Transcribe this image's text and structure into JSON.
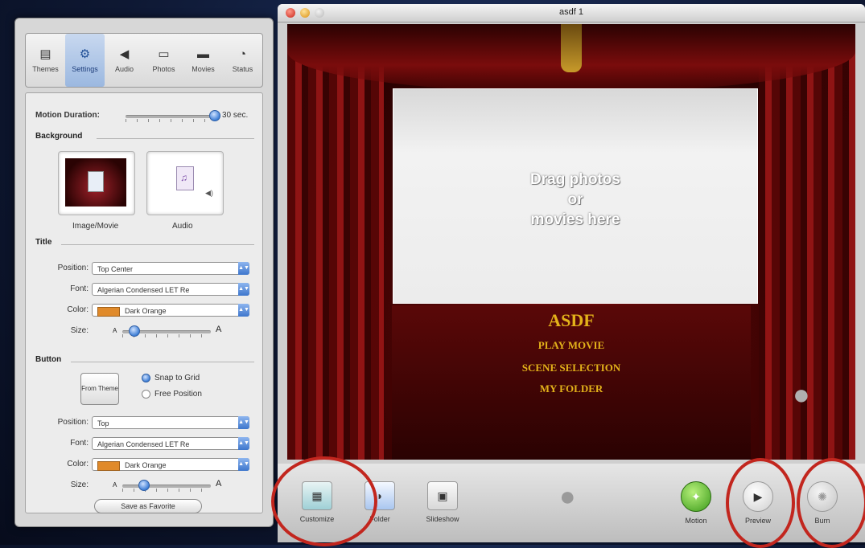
{
  "drawer": {
    "tabs": [
      {
        "label": "Themes",
        "icon": "themes-icon",
        "glyph": "▤"
      },
      {
        "label": "Settings",
        "icon": "gear-icon",
        "glyph": "⚙"
      },
      {
        "label": "Audio",
        "icon": "speaker-icon",
        "glyph": "◀"
      },
      {
        "label": "Photos",
        "icon": "photo-icon",
        "glyph": "▭"
      },
      {
        "label": "Movies",
        "icon": "film-icon",
        "glyph": "▬"
      },
      {
        "label": "Status",
        "icon": "status-icon",
        "glyph": "◔"
      }
    ],
    "active_tab": "Settings",
    "motion_duration_label": "Motion Duration:",
    "motion_duration_value": "30 sec.",
    "background_heading": "Background",
    "image_movie_label": "Image/Movie",
    "audio_label": "Audio",
    "title_heading": "Title",
    "title_settings": {
      "position_label": "Position:",
      "position_value": "Top Center",
      "font_label": "Font:",
      "font_value": "Algerian Condensed LET Re",
      "color_label": "Color:",
      "color_value": "Dark Orange",
      "size_label": "Size:",
      "size_small": "A",
      "size_large": "A"
    },
    "button_heading": "Button",
    "from_theme_label": "From Theme",
    "snap_to_grid": "Snap to Grid",
    "free_position": "Free Position",
    "button_settings": {
      "position_label": "Position:",
      "position_value": "Top",
      "font_label": "Font:",
      "font_value": "Algerian Condensed LET Re",
      "color_label": "Color:",
      "color_value": "Dark Orange",
      "size_label": "Size:",
      "size_small": "A",
      "size_large": "A"
    },
    "save_favorite": "Save as Favorite",
    "colors": {
      "swatch": "#e08a2a",
      "accent": "#3f7fd6"
    }
  },
  "window": {
    "title": "asdf 1",
    "drop_zone": [
      "Drag photos",
      "or",
      "movies here"
    ],
    "menu_title": "ASDF",
    "menu_items": [
      "PLAY MOVIE",
      "SCENE SELECTION",
      "MY FOLDER"
    ],
    "toolbar": {
      "customize": "Customize",
      "folder": "Folder",
      "slideshow": "Slideshow",
      "motion": "Motion",
      "preview": "Preview",
      "burn": "Burn"
    },
    "colors": {
      "menu_text": "#e3b21a",
      "highlight_ring": "#c2261e",
      "curtain": "#7a0c0c"
    }
  }
}
